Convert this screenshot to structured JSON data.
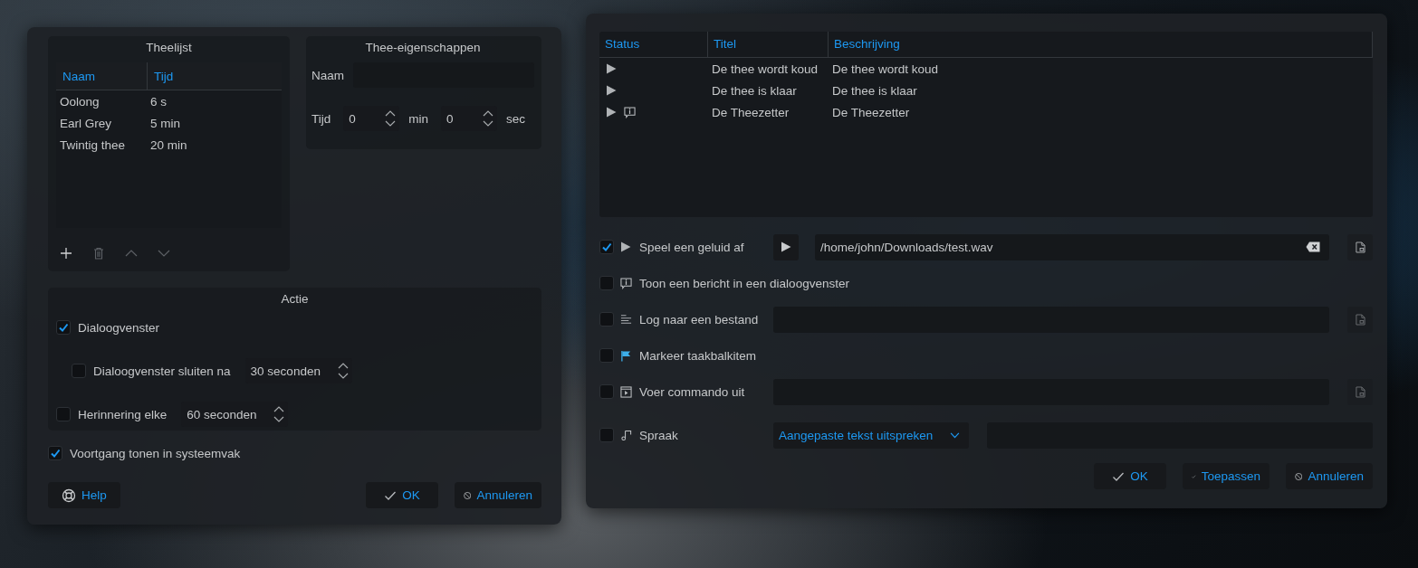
{
  "tea_dialog": {
    "tea_list": {
      "title": "Theelijst",
      "columns": [
        "Naam",
        "Tijd"
      ],
      "rows": [
        {
          "name": "Oolong",
          "time": "6 s"
        },
        {
          "name": "Earl Grey",
          "time": "5 min"
        },
        {
          "name": "Twintig thee",
          "time": "20 min"
        }
      ],
      "tools": [
        {
          "kind": "add",
          "disabled": false
        },
        {
          "kind": "delete",
          "disabled": true
        },
        {
          "kind": "up",
          "disabled": true
        },
        {
          "kind": "down",
          "disabled": true
        }
      ]
    },
    "properties": {
      "title": "Thee-eigenschappen",
      "name_label": "Naam",
      "time_label": "Tijd",
      "minutes": "0",
      "minutes_unit": "min",
      "seconds": "0",
      "seconds_unit": "sec"
    },
    "action": {
      "title": "Actie",
      "dialog": {
        "label": "Dialoogvenster",
        "checked": true
      },
      "close_after": {
        "label": "Dialoogvenster sluiten na",
        "checked": false,
        "value": "30 seconden"
      },
      "reminder": {
        "label": "Herinnering elke",
        "checked": false,
        "value": "60 seconden"
      }
    },
    "show_progress": {
      "label": "Voortgang tonen in systeemvak",
      "checked": true
    },
    "buttons": [
      {
        "kind": "help",
        "label": "Help"
      },
      {
        "kind": "ok",
        "label": "OK"
      },
      {
        "kind": "cancel",
        "label": "Annuleren"
      }
    ]
  },
  "notify_dialog": {
    "table": {
      "columns": [
        "Status",
        "Titel",
        "Beschrijving"
      ],
      "rows": [
        {
          "sound": true,
          "dialog": false,
          "title": "De thee wordt koud",
          "description": "De thee wordt koud"
        },
        {
          "sound": true,
          "dialog": false,
          "title": "De thee is klaar",
          "description": "De thee is klaar"
        },
        {
          "sound": true,
          "dialog": true,
          "title": "De Theezetter",
          "description": "De Theezetter"
        }
      ]
    },
    "actions": [
      {
        "kind": "sound",
        "label": "Speel een geluid af",
        "checked": true,
        "value": "/home/john/Downloads/test.wav"
      },
      {
        "kind": "dialog",
        "label": "Toon een bericht in een dialoogvenster",
        "checked": false
      },
      {
        "kind": "log",
        "label": "Log naar een bestand",
        "checked": false
      },
      {
        "kind": "taskbar",
        "label": "Markeer taakbalkitem",
        "checked": false
      },
      {
        "kind": "command",
        "label": "Voer commando uit",
        "checked": false
      },
      {
        "kind": "speech",
        "label": "Spraak",
        "checked": false,
        "combo": "Aangepaste tekst uitspreken"
      }
    ],
    "buttons": [
      {
        "kind": "ok",
        "label": "OK"
      },
      {
        "kind": "apply",
        "label": "Toepassen"
      },
      {
        "kind": "cancel",
        "label": "Annuleren"
      }
    ]
  }
}
